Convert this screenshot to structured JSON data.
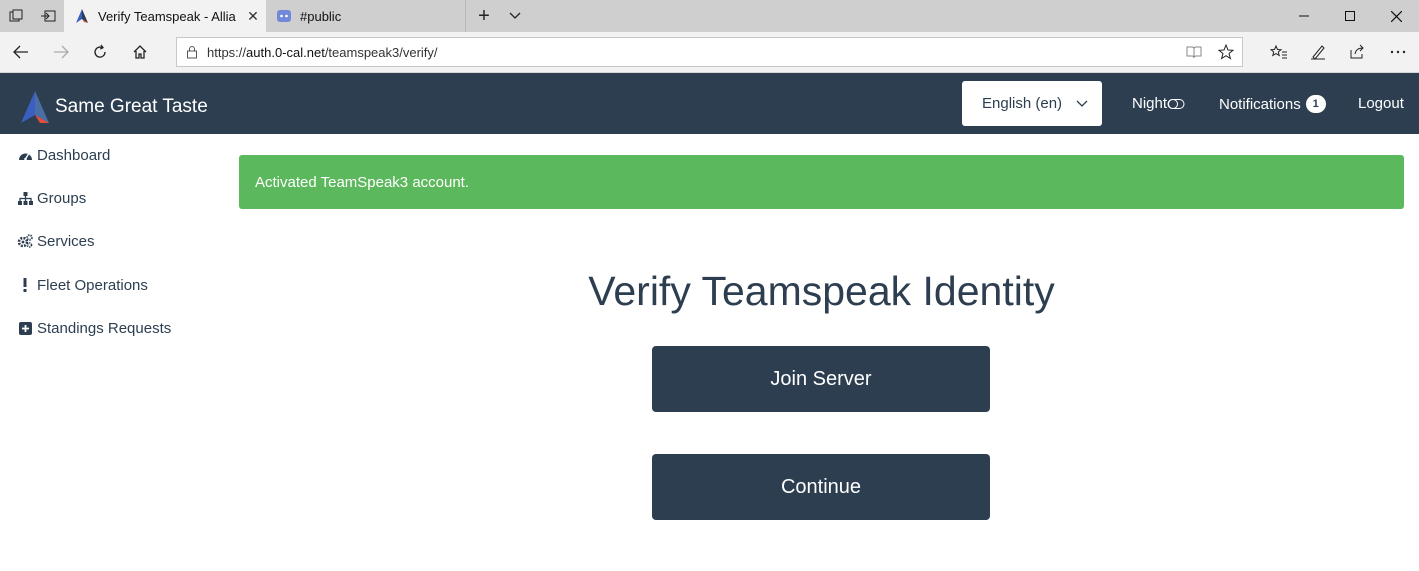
{
  "browser": {
    "tabs": [
      {
        "title": "Verify Teamspeak - Allia",
        "active": true,
        "favicon": "auth-logo-icon"
      },
      {
        "title": "#public",
        "active": false,
        "favicon": "discord-icon"
      }
    ],
    "address": {
      "scheme": "https://",
      "host": "auth.0-cal.net",
      "path": "/teamspeak3/verify/"
    }
  },
  "header": {
    "brand": "Same Great Taste",
    "language": "English (en)",
    "night_label": "Night",
    "notifications_label": "Notifications",
    "notifications_count": "1",
    "logout_label": "Logout"
  },
  "sidebar": {
    "items": [
      {
        "label": "Dashboard",
        "icon": "dashboard-icon"
      },
      {
        "label": "Groups",
        "icon": "sitemap-icon"
      },
      {
        "label": "Services",
        "icon": "cogs-icon"
      },
      {
        "label": "Fleet Operations",
        "icon": "exclamation-icon"
      },
      {
        "label": "Standings Requests",
        "icon": "plus-square-icon"
      }
    ]
  },
  "main": {
    "alert": "Activated TeamSpeak3 account.",
    "title": "Verify Teamspeak Identity",
    "join_button": "Join Server",
    "continue_button": "Continue"
  },
  "colors": {
    "header_bg": "#2c3e50",
    "alert_bg": "#5cb85c",
    "button_bg": "#2c3e50",
    "logo_blue": "#3b5fc0",
    "logo_red": "#e74c3c"
  }
}
